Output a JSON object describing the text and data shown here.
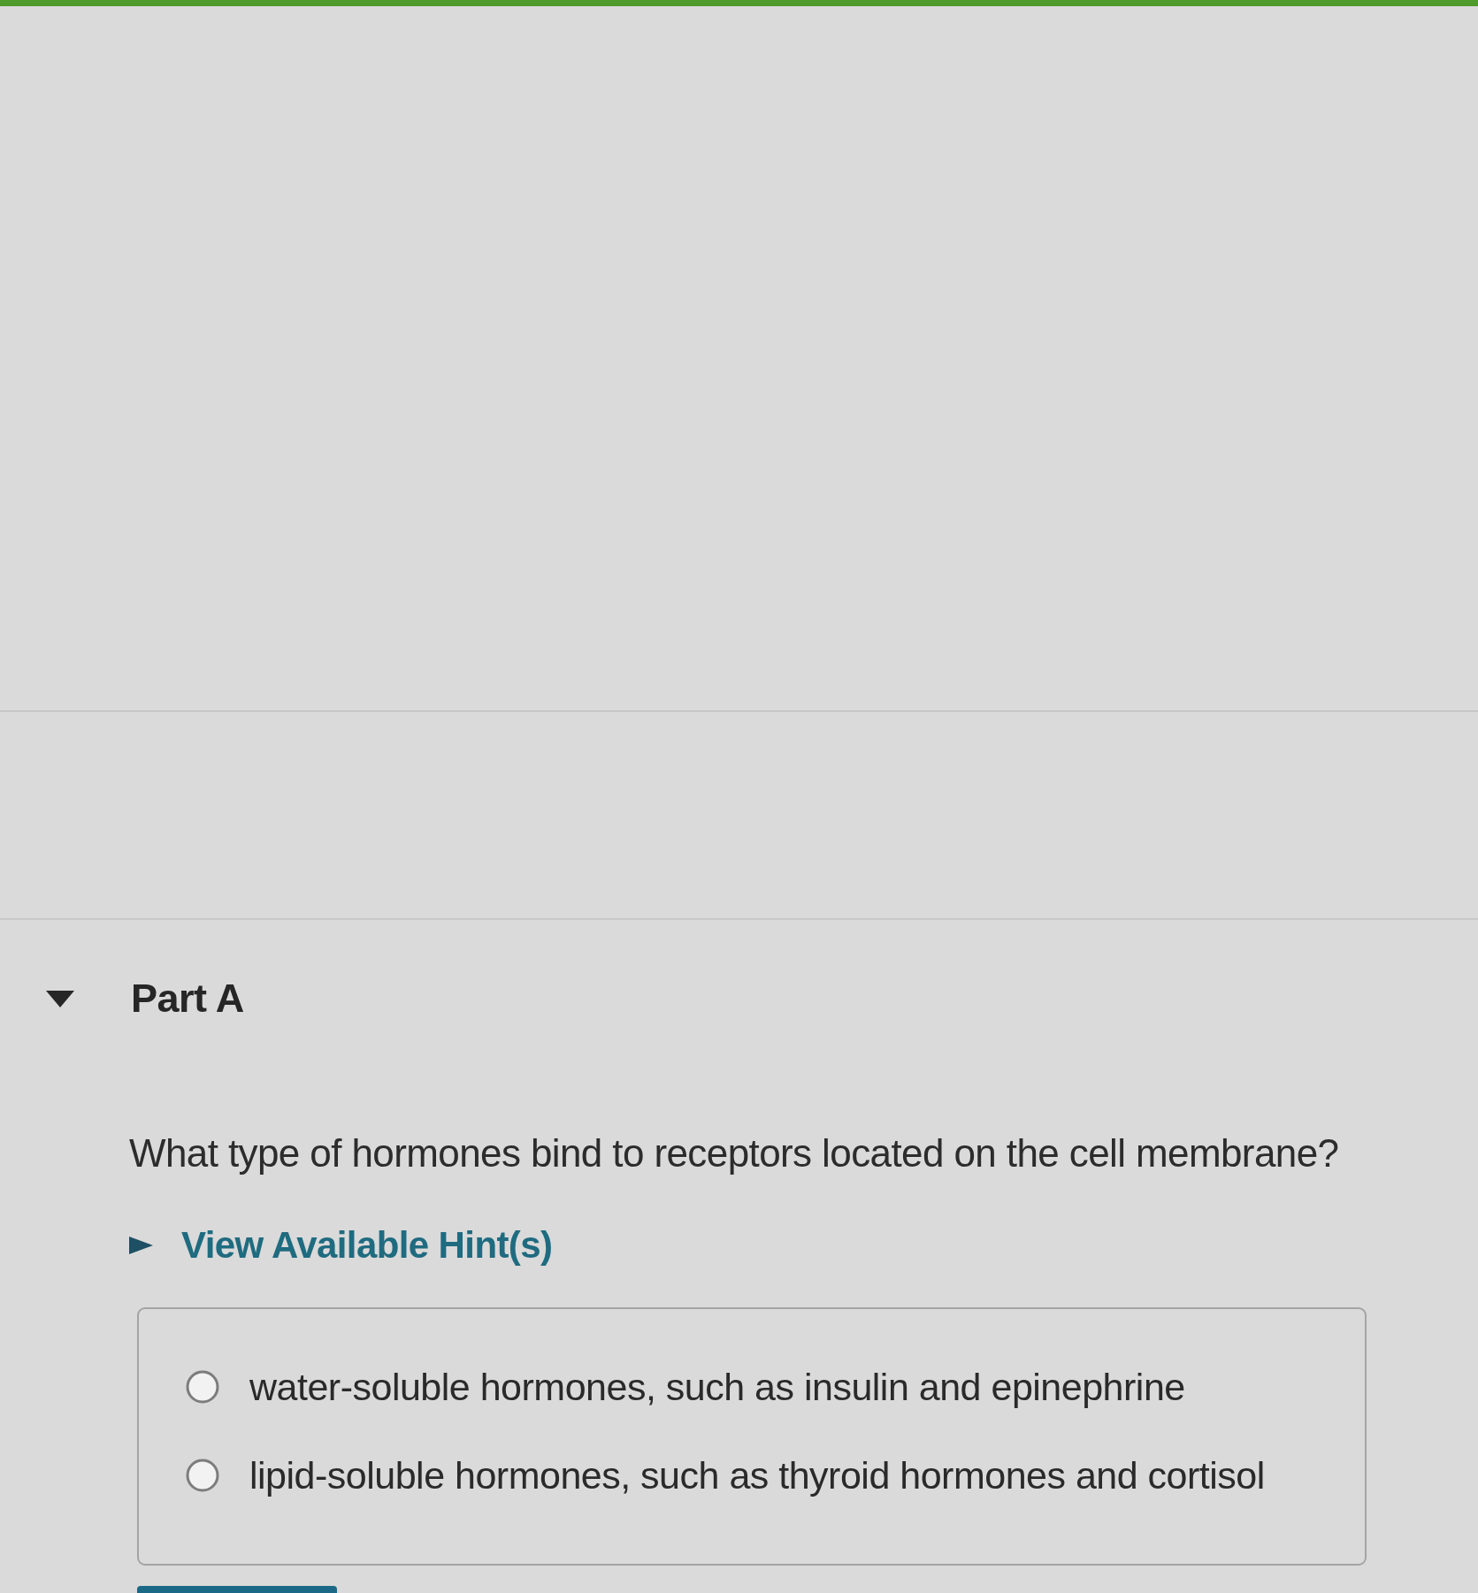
{
  "part": {
    "title": "Part A",
    "expanded": true
  },
  "question": "What type of hormones bind to receptors located on the cell membrane?",
  "hint_toggle": {
    "label": "View Available Hint(s)",
    "expanded": false
  },
  "choices": [
    {
      "label": "water-soluble hormones, such as insulin and epinephrine",
      "selected": false
    },
    {
      "label": "lipid-soluble hormones, such as thyroid hormones and cortisol",
      "selected": false
    }
  ]
}
